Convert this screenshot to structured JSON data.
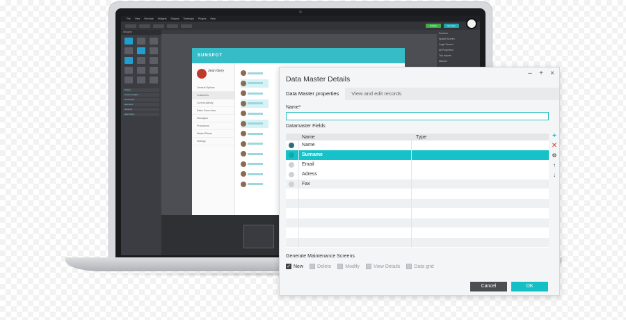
{
  "app": {
    "menu": [
      "File",
      "View",
      "Simulate",
      "Widgets",
      "Shapes",
      "Treemaps",
      "Plugins",
      "Help"
    ],
    "toolbar_buttons": [
      "Publish",
      "Simulate"
    ],
    "left_panel_header": "Widgets",
    "left_panel_items": [
      "Master",
      "Custom widget",
      "Generated",
      "Elements",
      "Screens",
      "Jean Grey"
    ],
    "right_panel_rows": [
      "Screens",
      "Splash Screen",
      "Login Screen",
      "All Properties",
      "Trip reports",
      "Albums"
    ]
  },
  "mockup": {
    "logo": "SUNSPOT",
    "user_name": "Jean Grey",
    "nav": [
      "General Options",
      "Customers",
      "Current Activity",
      "Sales Force Area",
      "Messages",
      "Promotions",
      "Market Places",
      "Settings"
    ],
    "active_nav_index": 1
  },
  "dialog": {
    "title": "Data Master Details",
    "window_controls": [
      "–",
      "+",
      "×"
    ],
    "tabs": [
      "Data Master properties",
      "View and edit records"
    ],
    "active_tab": 0,
    "name_label": "Name*",
    "name_value": "",
    "fields_label": "Datamaster Fields",
    "columns": [
      "Name",
      "Type"
    ],
    "fields": [
      {
        "name": "Name",
        "type": "",
        "checked": true,
        "selected": false
      },
      {
        "name": "Surname",
        "type": "",
        "checked": false,
        "selected": true
      },
      {
        "name": "Email",
        "type": "",
        "checked": false,
        "selected": false
      },
      {
        "name": "Adress",
        "type": "",
        "checked": false,
        "selected": false
      },
      {
        "name": "Fax",
        "type": "",
        "checked": false,
        "selected": false
      }
    ],
    "side_tools": {
      "add": "+",
      "delete": "✕",
      "settings": "⚙",
      "up": "↑",
      "down": "↓"
    },
    "maintenance_label": "Generate Maintenance Screens",
    "maintenance_options": [
      {
        "label": "New",
        "checked": true
      },
      {
        "label": "Delete",
        "checked": false
      },
      {
        "label": "Modify",
        "checked": false
      },
      {
        "label": "View Details",
        "checked": false
      },
      {
        "label": "Data grid",
        "checked": false
      }
    ],
    "cancel_label": "Cancel",
    "ok_label": "OK"
  },
  "colors": {
    "accent": "#14c0c6",
    "selected_row": "#16c2c9",
    "delete": "#d9402b",
    "cancel_button": "#4a4d52"
  }
}
